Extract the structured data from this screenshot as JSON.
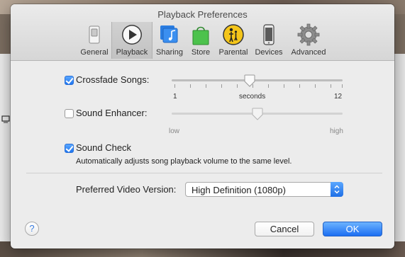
{
  "window": {
    "title": "Playback Preferences"
  },
  "tabs": [
    {
      "label": "General",
      "icon": "switch-icon"
    },
    {
      "label": "Playback",
      "icon": "play-icon",
      "active": true
    },
    {
      "label": "Sharing",
      "icon": "music-library-icon"
    },
    {
      "label": "Store",
      "icon": "shopping-bag-icon"
    },
    {
      "label": "Parental",
      "icon": "parental-control-icon"
    },
    {
      "label": "Devices",
      "icon": "iphone-icon"
    },
    {
      "label": "Advanced",
      "icon": "gear-icon"
    }
  ],
  "crossfade": {
    "label": "Crossfade Songs:",
    "checked": true,
    "min_label": "1",
    "unit_label": "seconds",
    "max_label": "12",
    "min": 1,
    "max": 12,
    "value": 6
  },
  "enhancer": {
    "label": "Sound Enhancer:",
    "checked": false,
    "low_label": "low",
    "high_label": "high",
    "value_fraction": 0.5
  },
  "sound_check": {
    "label": "Sound Check",
    "checked": true,
    "description": "Automatically adjusts song playback volume to the same level."
  },
  "video": {
    "label": "Preferred Video Version:",
    "selected": "High Definition (1080p)"
  },
  "buttons": {
    "cancel": "Cancel",
    "ok": "OK",
    "help": "?"
  },
  "colors": {
    "accent": "#1f76f0",
    "window_bg": "#ececec"
  }
}
